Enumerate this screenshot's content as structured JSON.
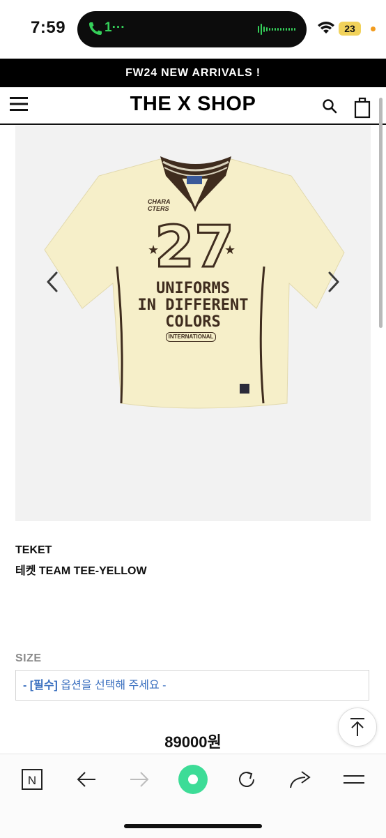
{
  "status_bar": {
    "time": "7:59",
    "call_text": "1···",
    "battery": "23"
  },
  "promo_banner": {
    "text": "FW24 NEW ARRIVALS !"
  },
  "header": {
    "brand": "THE X SHOP"
  },
  "product": {
    "brand": "TEKET",
    "name": "테켓 TEAM TEE-YELLOW",
    "shirt_print": {
      "chest_logo": "CHARA CTERS",
      "number": "27",
      "line1": "UNIFORMS",
      "line2": "IN DIFFERENT",
      "line3": "COLORS",
      "badge": "INTERNATIONAL"
    },
    "price": "89000원",
    "colors": {
      "shirt": "#f6efc9",
      "trim": "#3f2c1e"
    }
  },
  "options": {
    "label": "SIZE",
    "select_prefix": "- ",
    "select_required": "[필수]",
    "select_text": " 옵션을 선택해 주세요 -"
  },
  "icons": {
    "menu": "hamburger-icon",
    "search": "search-icon",
    "bag": "shopping-bag-icon",
    "scroll_top": "arrow-up-icon",
    "toolbar": [
      "n-icon",
      "back-arrow-icon",
      "forward-arrow-icon",
      "record-icon",
      "refresh-icon",
      "share-icon",
      "menu-icon"
    ]
  },
  "colors": {
    "accent": "#3a6fbf",
    "record": "#3ddc97",
    "call_green": "#35d05a"
  }
}
